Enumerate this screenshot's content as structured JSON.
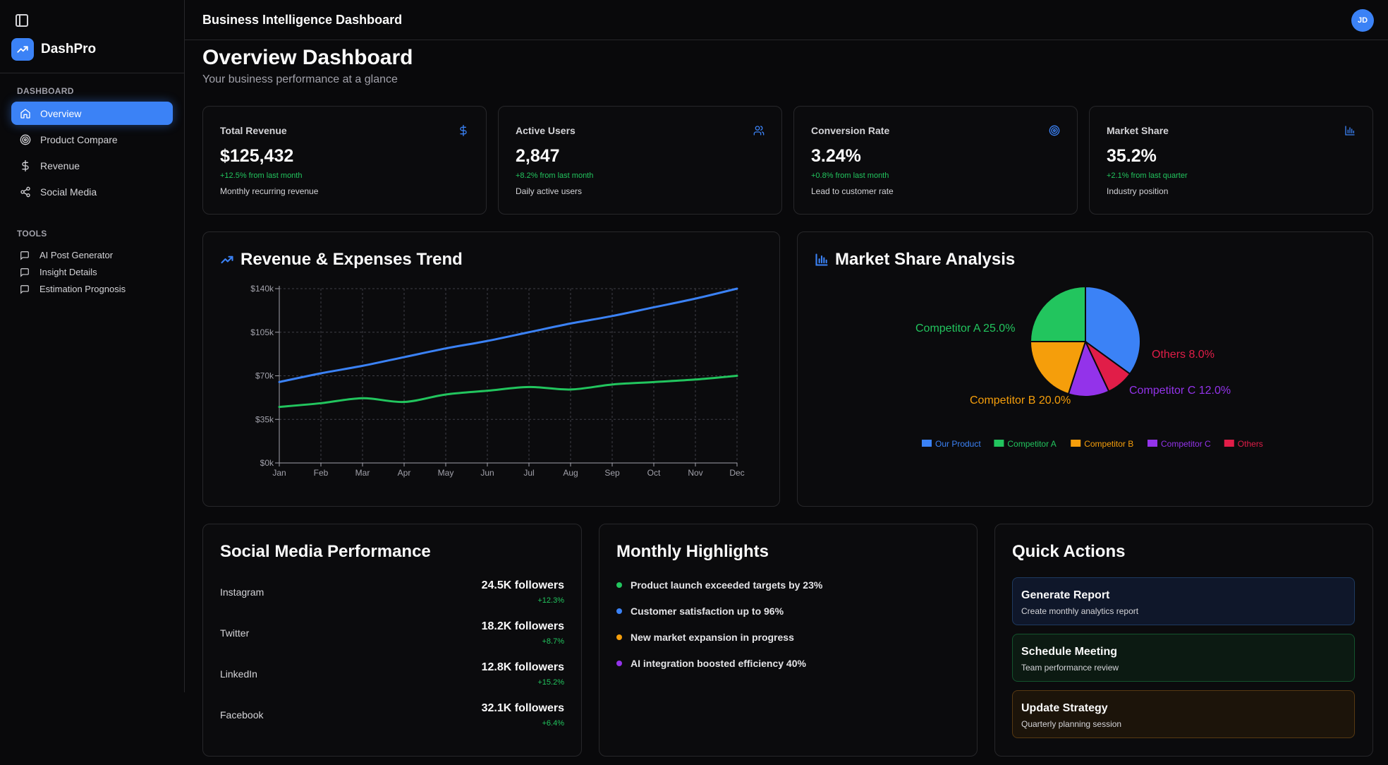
{
  "app": {
    "name": "DashPro",
    "header_title": "Business Intelligence Dashboard",
    "user_initials": "JD"
  },
  "sidebar": {
    "dashboard_label": "DASHBOARD",
    "items": [
      {
        "label": "Overview",
        "icon": "home-icon",
        "active": true
      },
      {
        "label": "Product Compare",
        "icon": "target-icon"
      },
      {
        "label": "Revenue",
        "icon": "dollar-icon"
      },
      {
        "label": "Social Media",
        "icon": "share-icon"
      }
    ],
    "tools_label": "TOOLS",
    "tools": [
      {
        "label": "AI Post Generator",
        "icon": "message-icon"
      },
      {
        "label": "Insight Details",
        "icon": "message-icon"
      },
      {
        "label": "Estimation Prognosis",
        "icon": "message-icon"
      }
    ]
  },
  "page": {
    "title": "Overview Dashboard",
    "subtitle": "Your business performance at a glance"
  },
  "stats": [
    {
      "label": "Total Revenue",
      "value": "$125,432",
      "change": "+12.5% from last month",
      "desc": "Monthly recurring revenue",
      "icon": "dollar-icon"
    },
    {
      "label": "Active Users",
      "value": "2,847",
      "change": "+8.2% from last month",
      "desc": "Daily active users",
      "icon": "users-icon"
    },
    {
      "label": "Conversion Rate",
      "value": "3.24%",
      "change": "+0.8% from last month",
      "desc": "Lead to customer rate",
      "icon": "target-icon"
    },
    {
      "label": "Market Share",
      "value": "35.2%",
      "change": "+2.1% from last quarter",
      "desc": "Industry position",
      "icon": "bar-chart-icon"
    }
  ],
  "colors": {
    "accent": "#3b82f6",
    "green": "#22c55e",
    "orange": "#f59e0b",
    "purple": "#9333ea",
    "pink": "#e11d48"
  },
  "revenue_chart_title": "Revenue & Expenses Trend",
  "market_chart_title": "Market Share Analysis",
  "chart_data": [
    {
      "type": "line",
      "title": "Revenue & Expenses Trend",
      "x": [
        "Jan",
        "Feb",
        "Mar",
        "Apr",
        "May",
        "Jun",
        "Jul",
        "Aug",
        "Sep",
        "Oct",
        "Nov",
        "Dec"
      ],
      "y_ticks": [
        "$0k",
        "$35k",
        "$70k",
        "$105k",
        "$140k"
      ],
      "ylim": [
        0,
        140000
      ],
      "grid": true,
      "series": [
        {
          "color": "#3b82f6",
          "values": [
            65000,
            72000,
            78000,
            85000,
            92000,
            98000,
            105000,
            112000,
            118000,
            125000,
            132000,
            140000
          ]
        },
        {
          "color": "#22c55e",
          "values": [
            45000,
            48000,
            52000,
            49000,
            55000,
            58000,
            61000,
            59000,
            63000,
            65000,
            67000,
            70000
          ]
        }
      ]
    },
    {
      "type": "pie",
      "title": "Market Share Analysis",
      "slices": [
        {
          "name": "Our Product",
          "value": 35,
          "color": "#3b82f6",
          "label": ""
        },
        {
          "name": "Others",
          "value": 8,
          "color": "#e11d48",
          "label": "Others 8.0%"
        },
        {
          "name": "Competitor C",
          "value": 12,
          "color": "#9333ea",
          "label": "Competitor C 12.0%"
        },
        {
          "name": "Competitor B",
          "value": 20,
          "color": "#f59e0b",
          "label": "Competitor B 20.0%"
        },
        {
          "name": "Competitor A",
          "value": 25,
          "color": "#22c55e",
          "label": "Competitor A 25.0%"
        }
      ],
      "legend": [
        "Our Product",
        "Competitor A",
        "Competitor B",
        "Competitor C",
        "Others"
      ],
      "legend_position": "bottom"
    }
  ],
  "social": {
    "title": "Social Media Performance",
    "rows": [
      {
        "name": "Instagram",
        "followers": "24.5K followers",
        "growth": "+12.3%"
      },
      {
        "name": "Twitter",
        "followers": "18.2K followers",
        "growth": "+8.7%"
      },
      {
        "name": "LinkedIn",
        "followers": "12.8K followers",
        "growth": "+15.2%"
      },
      {
        "name": "Facebook",
        "followers": "32.1K followers",
        "growth": "+6.4%"
      }
    ]
  },
  "highlights": {
    "title": "Monthly Highlights",
    "items": [
      {
        "text": "Product launch exceeded targets by 23%",
        "color": "#22c55e"
      },
      {
        "text": "Customer satisfaction up to 96%",
        "color": "#3b82f6"
      },
      {
        "text": "New market expansion in progress",
        "color": "#f59e0b"
      },
      {
        "text": "AI integration boosted efficiency 40%",
        "color": "#9333ea"
      }
    ]
  },
  "quick_actions": {
    "title": "Quick Actions",
    "items": [
      {
        "title": "Generate Report",
        "desc": "Create monthly analytics report"
      },
      {
        "title": "Schedule Meeting",
        "desc": "Team performance review"
      },
      {
        "title": "Update Strategy",
        "desc": "Quarterly planning session"
      }
    ]
  }
}
